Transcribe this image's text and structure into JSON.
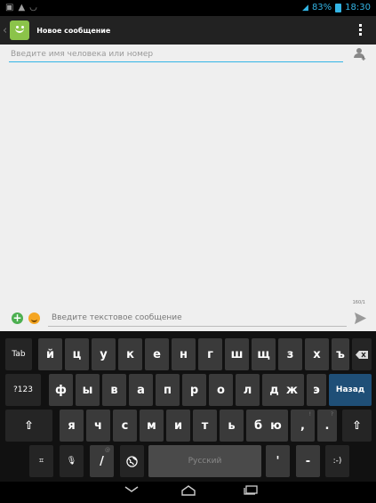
{
  "status_bar": {
    "battery_text": "83%",
    "time": "18:30"
  },
  "action_bar": {
    "title": "Новое сообщение"
  },
  "recipient": {
    "placeholder": "Введите имя человека или номер"
  },
  "compose": {
    "placeholder": "Введите текстовое сообщение",
    "counter": "160/1"
  },
  "keyboard": {
    "row1": [
      "Tab",
      "й",
      "ц",
      "у",
      "к",
      "е",
      "н",
      "г",
      "ш",
      "щ",
      "з",
      "х",
      "ъ"
    ],
    "row2": [
      "?123",
      "ф",
      "ы",
      "в",
      "а",
      "п",
      "р",
      "о",
      "л",
      "д",
      "ж",
      "э",
      "Назад"
    ],
    "row3": [
      "я",
      "ч",
      "с",
      "м",
      "и",
      "т",
      "ь",
      "б",
      "ю",
      ",",
      "."
    ],
    "row3_hints": [
      "!",
      "?"
    ],
    "row4": {
      "slash": "/",
      "slash_hint": "@",
      "space": "Русский",
      "apostrophe": "'",
      "dash": "-",
      "smiley": ":-)"
    }
  },
  "colors": {
    "accent": "#33b5e5",
    "enter_key": "#1f4f77",
    "app_icon": "#8bc34a"
  }
}
